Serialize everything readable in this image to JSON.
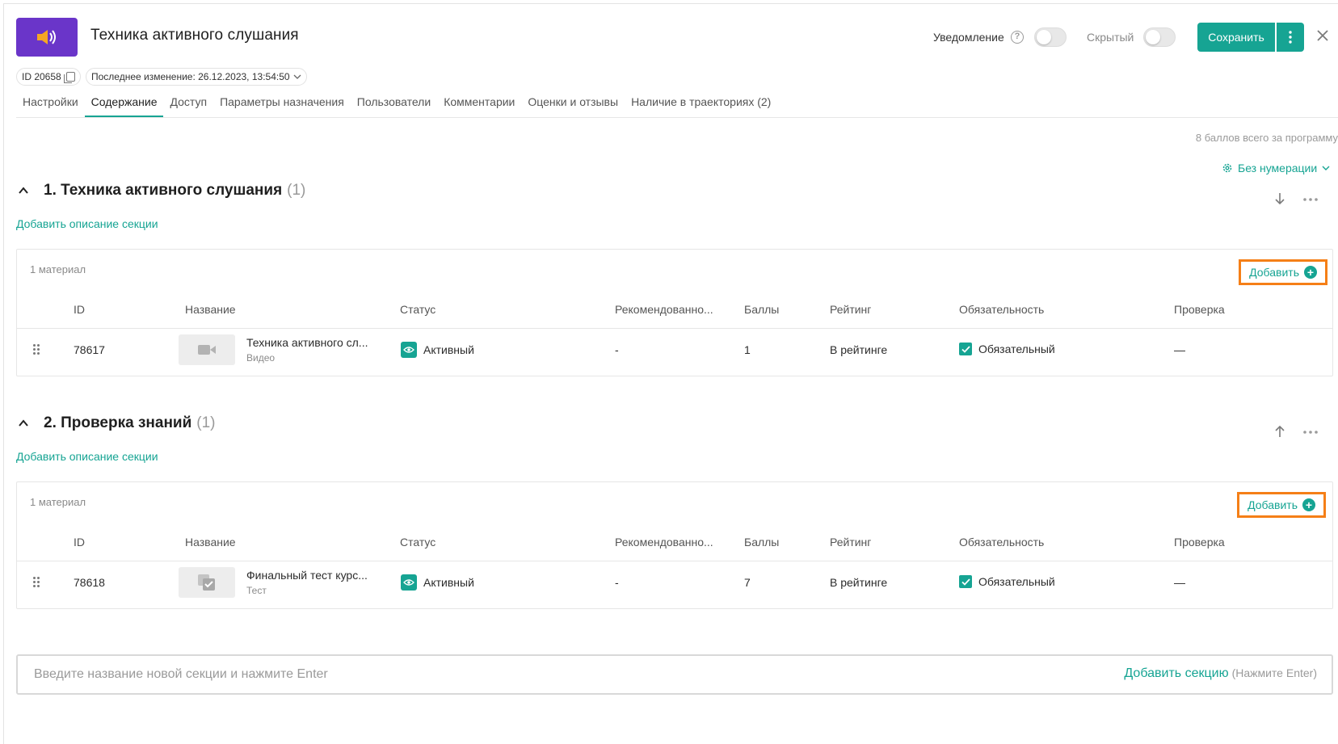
{
  "header": {
    "title": "Техника активного слушания",
    "notification_label": "Уведомление",
    "hidden_label": "Скрытый",
    "save_label": "Сохранить",
    "brand_color": "#16a493",
    "logo_color": "#6a35c9"
  },
  "meta": {
    "id_label": "ID 20658",
    "last_change": "Последнее изменение: 26.12.2023, 13:54:50"
  },
  "tabs": [
    {
      "label": "Настройки",
      "active": false
    },
    {
      "label": "Содержание",
      "active": true
    },
    {
      "label": "Доступ",
      "active": false
    },
    {
      "label": "Параметры назначения",
      "active": false
    },
    {
      "label": "Пользователи",
      "active": false
    },
    {
      "label": "Комментарии",
      "active": false
    },
    {
      "label": "Оценки и отзывы",
      "active": false
    },
    {
      "label": "Наличие в траекториях (2)",
      "active": false
    }
  ],
  "content": {
    "total_points": "8 баллов всего за программу",
    "numbering_label": "Без нумерации",
    "add_description": "Добавить описание секции",
    "add_label": "Добавить",
    "columns": [
      "ID",
      "Название",
      "Статус",
      "Рекомендованно...",
      "Баллы",
      "Рейтинг",
      "Обязательность",
      "Проверка"
    ],
    "sections": [
      {
        "title": "1. Техника активного слушания",
        "count": "(1)",
        "arrow": "down",
        "materials_count": "1 материал",
        "rows": [
          {
            "id": "78617",
            "name": "Техника активного сл...",
            "type": "Видео",
            "status": "Активный",
            "recommended": "-",
            "points": "1",
            "rating": "В рейтинге",
            "required": "Обязательный",
            "check": "—",
            "thumb_icon": "video-camera-icon"
          }
        ]
      },
      {
        "title": "2. Проверка знаний",
        "count": "(1)",
        "arrow": "up",
        "materials_count": "1 материал",
        "rows": [
          {
            "id": "78618",
            "name": "Финальный тест курс...",
            "type": "Тест",
            "status": "Активный",
            "recommended": "-",
            "points": "7",
            "rating": "В рейтинге",
            "required": "Обязательный",
            "check": "—",
            "thumb_icon": "test-check-icon"
          }
        ]
      }
    ]
  },
  "new_section": {
    "placeholder": "Введите название новой секции и нажмите Enter",
    "add_label": "Добавить секцию",
    "hint": "(Нажмите Enter)"
  }
}
